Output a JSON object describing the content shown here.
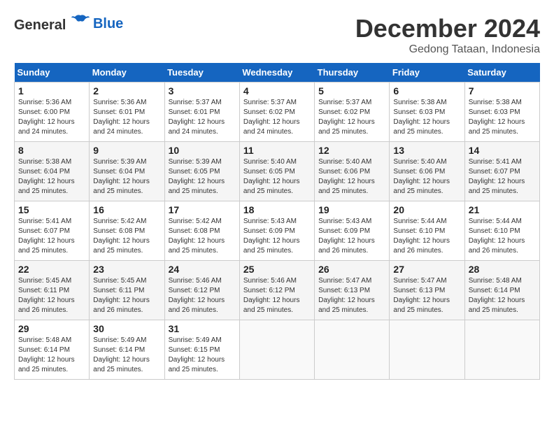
{
  "header": {
    "logo_general": "General",
    "logo_blue": "Blue",
    "month_title": "December 2024",
    "subtitle": "Gedong Tataan, Indonesia"
  },
  "calendar": {
    "days_of_week": [
      "Sunday",
      "Monday",
      "Tuesday",
      "Wednesday",
      "Thursday",
      "Friday",
      "Saturday"
    ],
    "weeks": [
      [
        {
          "day": "",
          "info": ""
        },
        {
          "day": "2",
          "info": "Sunrise: 5:36 AM\nSunset: 6:01 PM\nDaylight: 12 hours\nand 24 minutes."
        },
        {
          "day": "3",
          "info": "Sunrise: 5:37 AM\nSunset: 6:01 PM\nDaylight: 12 hours\nand 24 minutes."
        },
        {
          "day": "4",
          "info": "Sunrise: 5:37 AM\nSunset: 6:02 PM\nDaylight: 12 hours\nand 24 minutes."
        },
        {
          "day": "5",
          "info": "Sunrise: 5:37 AM\nSunset: 6:02 PM\nDaylight: 12 hours\nand 25 minutes."
        },
        {
          "day": "6",
          "info": "Sunrise: 5:38 AM\nSunset: 6:03 PM\nDaylight: 12 hours\nand 25 minutes."
        },
        {
          "day": "7",
          "info": "Sunrise: 5:38 AM\nSunset: 6:03 PM\nDaylight: 12 hours\nand 25 minutes."
        }
      ],
      [
        {
          "day": "1",
          "info": "Sunrise: 5:36 AM\nSunset: 6:00 PM\nDaylight: 12 hours\nand 24 minutes."
        },
        {
          "day": "",
          "info": ""
        },
        {
          "day": "",
          "info": ""
        },
        {
          "day": "",
          "info": ""
        },
        {
          "day": "",
          "info": ""
        },
        {
          "day": "",
          "info": ""
        },
        {
          "day": "",
          "info": ""
        }
      ],
      [
        {
          "day": "8",
          "info": "Sunrise: 5:38 AM\nSunset: 6:04 PM\nDaylight: 12 hours\nand 25 minutes."
        },
        {
          "day": "9",
          "info": "Sunrise: 5:39 AM\nSunset: 6:04 PM\nDaylight: 12 hours\nand 25 minutes."
        },
        {
          "day": "10",
          "info": "Sunrise: 5:39 AM\nSunset: 6:05 PM\nDaylight: 12 hours\nand 25 minutes."
        },
        {
          "day": "11",
          "info": "Sunrise: 5:40 AM\nSunset: 6:05 PM\nDaylight: 12 hours\nand 25 minutes."
        },
        {
          "day": "12",
          "info": "Sunrise: 5:40 AM\nSunset: 6:06 PM\nDaylight: 12 hours\nand 25 minutes."
        },
        {
          "day": "13",
          "info": "Sunrise: 5:40 AM\nSunset: 6:06 PM\nDaylight: 12 hours\nand 25 minutes."
        },
        {
          "day": "14",
          "info": "Sunrise: 5:41 AM\nSunset: 6:07 PM\nDaylight: 12 hours\nand 25 minutes."
        }
      ],
      [
        {
          "day": "15",
          "info": "Sunrise: 5:41 AM\nSunset: 6:07 PM\nDaylight: 12 hours\nand 25 minutes."
        },
        {
          "day": "16",
          "info": "Sunrise: 5:42 AM\nSunset: 6:08 PM\nDaylight: 12 hours\nand 25 minutes."
        },
        {
          "day": "17",
          "info": "Sunrise: 5:42 AM\nSunset: 6:08 PM\nDaylight: 12 hours\nand 25 minutes."
        },
        {
          "day": "18",
          "info": "Sunrise: 5:43 AM\nSunset: 6:09 PM\nDaylight: 12 hours\nand 25 minutes."
        },
        {
          "day": "19",
          "info": "Sunrise: 5:43 AM\nSunset: 6:09 PM\nDaylight: 12 hours\nand 26 minutes."
        },
        {
          "day": "20",
          "info": "Sunrise: 5:44 AM\nSunset: 6:10 PM\nDaylight: 12 hours\nand 26 minutes."
        },
        {
          "day": "21",
          "info": "Sunrise: 5:44 AM\nSunset: 6:10 PM\nDaylight: 12 hours\nand 26 minutes."
        }
      ],
      [
        {
          "day": "22",
          "info": "Sunrise: 5:45 AM\nSunset: 6:11 PM\nDaylight: 12 hours\nand 26 minutes."
        },
        {
          "day": "23",
          "info": "Sunrise: 5:45 AM\nSunset: 6:11 PM\nDaylight: 12 hours\nand 26 minutes."
        },
        {
          "day": "24",
          "info": "Sunrise: 5:46 AM\nSunset: 6:12 PM\nDaylight: 12 hours\nand 26 minutes."
        },
        {
          "day": "25",
          "info": "Sunrise: 5:46 AM\nSunset: 6:12 PM\nDaylight: 12 hours\nand 25 minutes."
        },
        {
          "day": "26",
          "info": "Sunrise: 5:47 AM\nSunset: 6:13 PM\nDaylight: 12 hours\nand 25 minutes."
        },
        {
          "day": "27",
          "info": "Sunrise: 5:47 AM\nSunset: 6:13 PM\nDaylight: 12 hours\nand 25 minutes."
        },
        {
          "day": "28",
          "info": "Sunrise: 5:48 AM\nSunset: 6:14 PM\nDaylight: 12 hours\nand 25 minutes."
        }
      ],
      [
        {
          "day": "29",
          "info": "Sunrise: 5:48 AM\nSunset: 6:14 PM\nDaylight: 12 hours\nand 25 minutes."
        },
        {
          "day": "30",
          "info": "Sunrise: 5:49 AM\nSunset: 6:14 PM\nDaylight: 12 hours\nand 25 minutes."
        },
        {
          "day": "31",
          "info": "Sunrise: 5:49 AM\nSunset: 6:15 PM\nDaylight: 12 hours\nand 25 minutes."
        },
        {
          "day": "",
          "info": ""
        },
        {
          "day": "",
          "info": ""
        },
        {
          "day": "",
          "info": ""
        },
        {
          "day": "",
          "info": ""
        }
      ]
    ]
  }
}
